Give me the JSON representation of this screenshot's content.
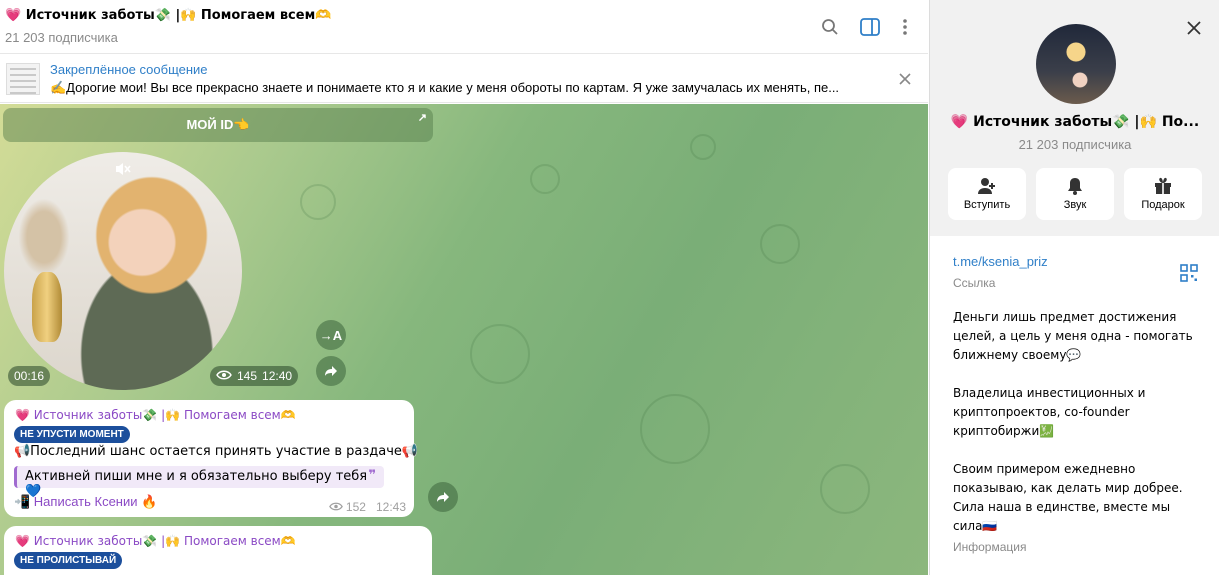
{
  "header": {
    "title": "💗 Источник заботы💸 |🙌 Помогаем всем🫶",
    "subscribers": "21 203 подписчика"
  },
  "pinned": {
    "title": "Закреплённое сообщение",
    "text": "✍️Дорогие мои! Вы все прекрасно знаете и понимаете кто я и какие у меня обороты по картам. Я уже замучалась их менять, пе..."
  },
  "chat": {
    "myid_button": "МОЙ ID👈",
    "video": {
      "duration": "00:16",
      "views": "145",
      "time": "12:40",
      "translate_label": "→A"
    },
    "message1": {
      "author": "💗 Источник заботы💸 |🙌 Помогаем всем🫶",
      "tag": "НЕ УПУСТИ МОМЕНТ",
      "line": "📢Последний шанс остается принять участие в раздаче📢",
      "quote": "Активней пиши мне и я обязательно выберу тебя💙",
      "quote_mark": "❞",
      "link": "📲 Написать Ксении 🔥",
      "views": "152",
      "time": "12:43"
    },
    "message2": {
      "author": "💗 Источник заботы💸 |🙌 Помогаем всем🫶",
      "tag": "НЕ ПРОЛИСТЫВАЙ"
    }
  },
  "panel": {
    "name": "💗 Источник заботы💸 |🙌 По...",
    "subscribers": "21 203 подписчика",
    "actions": [
      {
        "label": "Вступить",
        "icon": "add-user-icon"
      },
      {
        "label": "Звук",
        "icon": "bell-icon"
      },
      {
        "label": "Подарок",
        "icon": "gift-icon"
      }
    ],
    "link": "t.me/ksenia_priz",
    "link_label": "Ссылка",
    "bio": "Деньги лишь предмет достижения целей, а цель у меня одна - помогать ближнему своему💬\n\nВладелица инвестиционных и криптопроектов, co-founder криптобиржи💹\n\nСвоим примером ежедневно показываю, как делать мир добрее. Сила наша в единстве, вместе мы сила🇷🇺",
    "bio_label": "Информация"
  }
}
